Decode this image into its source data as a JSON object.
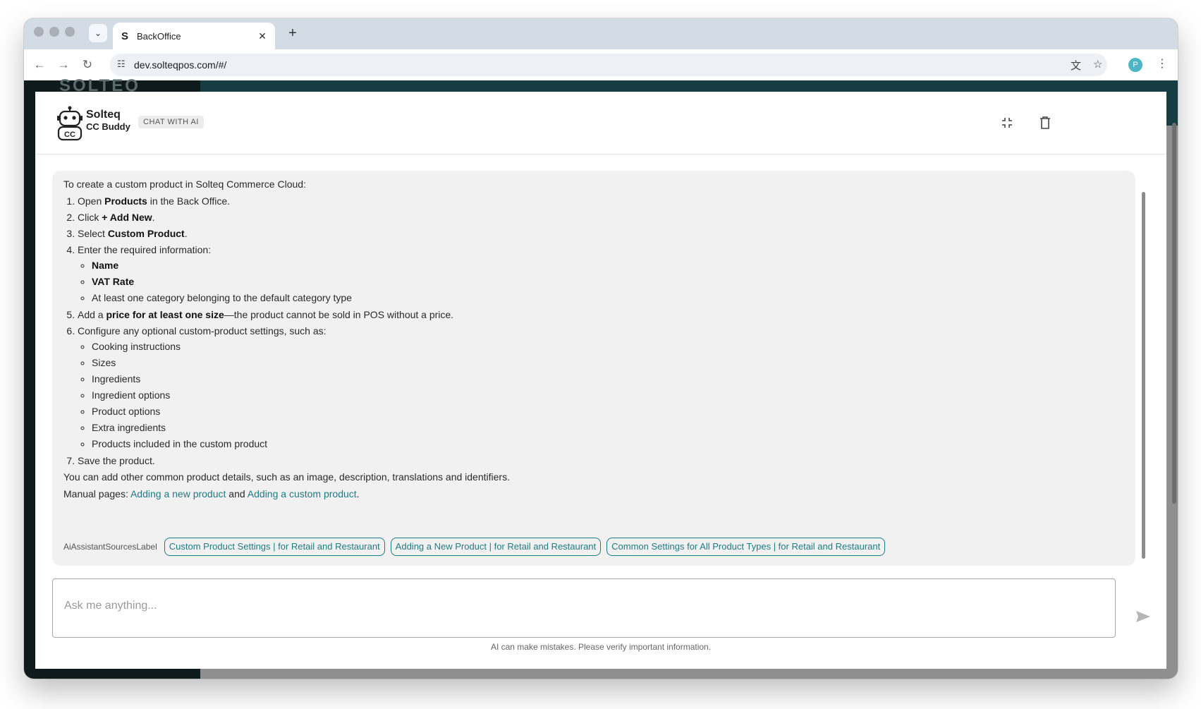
{
  "browser": {
    "tab_title": "BackOffice",
    "tab_favicon": "S",
    "url": "dev.solteqpos.com/#/",
    "profile_initial": "P",
    "icons": [
      "tab-dropdown-icon",
      "close-icon",
      "plus-icon",
      "back-icon",
      "forward-icon",
      "reload-icon",
      "site-settings-icon",
      "translate-icon",
      "star-icon",
      "kebab-menu-icon"
    ]
  },
  "chat": {
    "brand_line1": "Solteq",
    "brand_line2": "CC Buddy",
    "brand_badge": "CC",
    "badge": "CHAT WITH AI",
    "header_icons": [
      "minimize-icon",
      "delete-icon"
    ],
    "message": {
      "intro": "To create a custom product in Solteq Commerce Cloud:",
      "step1": {
        "pre": "Open ",
        "bold": "Products",
        "post": " in the Back Office."
      },
      "step2": {
        "pre": "Click ",
        "bold": "+ Add New",
        "post": "."
      },
      "step3": {
        "pre": "Select ",
        "bold": "Custom Product",
        "post": "."
      },
      "step4": {
        "text": "Enter the required information:",
        "items": [
          "Name",
          "VAT Rate",
          "At least one category belonging to the default category type"
        ]
      },
      "step5": {
        "pre": "Add a ",
        "bold": "price for at least one size",
        "post": "—the product cannot be sold in POS without a price."
      },
      "step6": {
        "text": "Configure any optional custom-product settings, such as:",
        "items": [
          "Cooking instructions",
          "Sizes",
          "Ingredients",
          "Ingredient options",
          "Product options",
          "Extra ingredients",
          "Products included in the custom product"
        ]
      },
      "step7": "Save the product.",
      "note": "You can add other common product details, such as an image, description, translations and identifiers.",
      "manual_prefix": "Manual pages: ",
      "manual_link1": "Adding a new product",
      "manual_and": " and ",
      "manual_link2": "Adding a custom product",
      "manual_suffix": "."
    },
    "sources_label": "AiAssistantSourcesLabel",
    "sources": [
      "Custom Product Settings | for Retail and Restaurant",
      "Adding a New Product | for Retail and Restaurant",
      "Common Settings for All Product Types | for Retail and Restaurant"
    ],
    "input_placeholder": "Ask me anything...",
    "disclaimer": "AI can make mistakes. Please verify important information."
  },
  "colors": {
    "link": "#1f7a83",
    "message_bg": "#f1f1f1",
    "page_header": "#163c44",
    "sidebar": "#0f1a1c"
  }
}
